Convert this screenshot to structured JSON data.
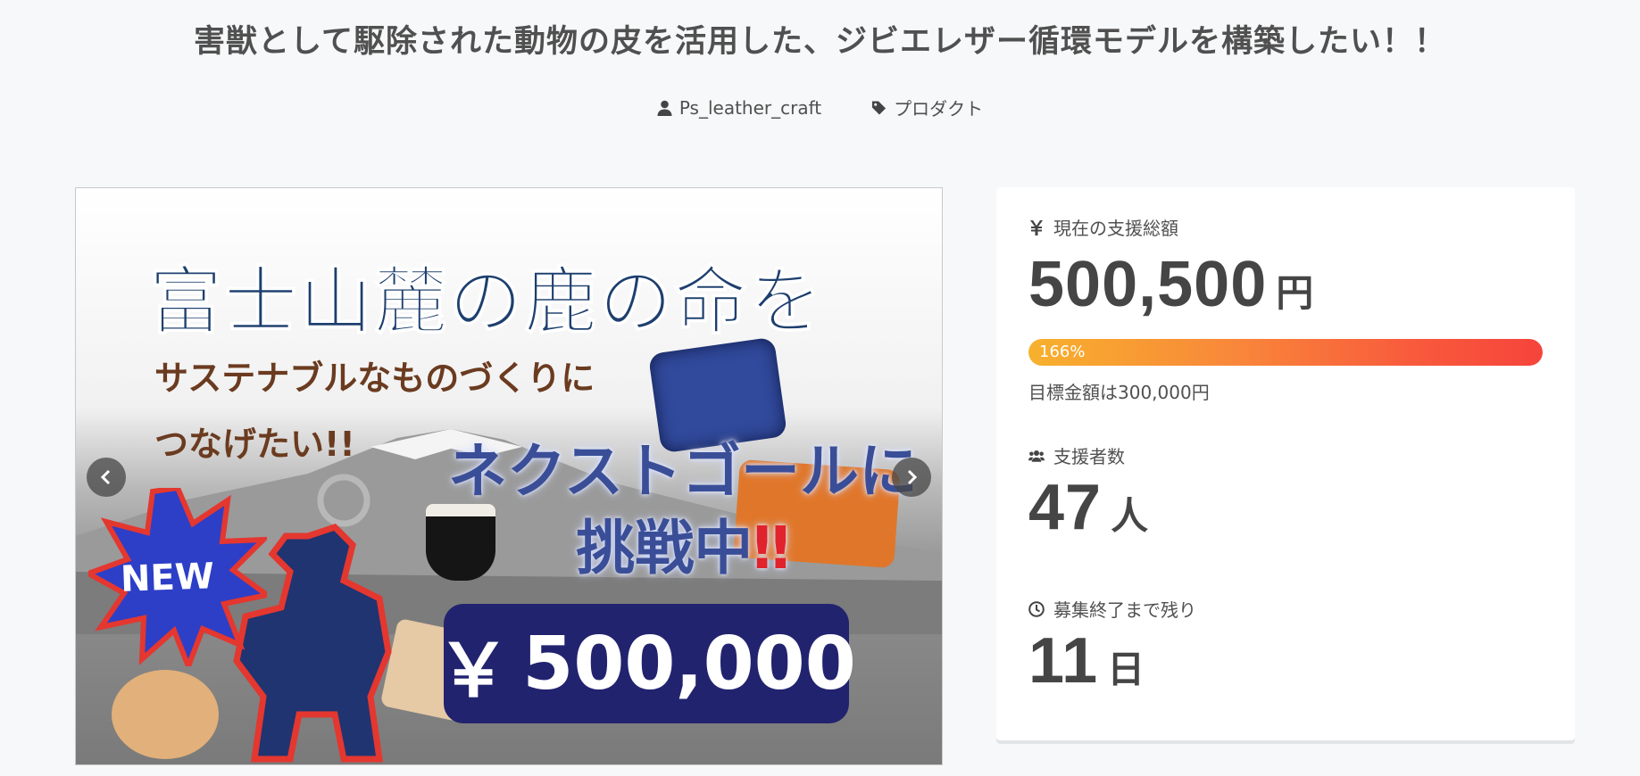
{
  "project": {
    "title": "害獣として駆除された動物の皮を活用した、ジビエレザー循環モデルを構築したい！！",
    "owner": "Ps_leather_craft",
    "category": "プロダクト"
  },
  "hero": {
    "headline": "富士山麓の鹿の命を",
    "sub1": "サステナブルなものづくりに",
    "sub2": "つなげたい!!",
    "next_goal_line1": "ネクストゴールに",
    "next_goal_line2": "挑戦中",
    "next_goal_bang": "‼",
    "badge": "NEW",
    "price_symbol": "￥",
    "price": "500,000"
  },
  "stats": {
    "total_label": "現在の支援総額",
    "total_amount": "500,500",
    "total_unit": "円",
    "progress_text": "166%",
    "progress_fraction": 1.0,
    "goal_text": "目標金額は300,000円",
    "backers_label": "支援者数",
    "backers_count": "47",
    "backers_unit": "人",
    "remaining_label": "募集終了まで残り",
    "remaining_count": "11",
    "remaining_unit": "日"
  },
  "icons": {
    "currency": "yen-icon",
    "people": "users-icon",
    "time": "clock-icon",
    "user": "user-icon",
    "tag": "tag-icon"
  }
}
